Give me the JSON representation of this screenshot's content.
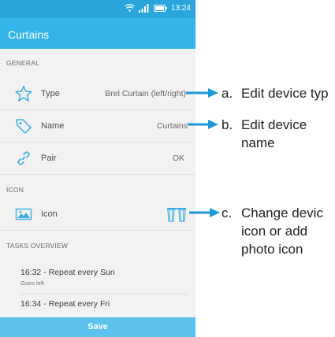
{
  "status_bar": {
    "time": "13:24"
  },
  "app_bar": {
    "title": "Curtains"
  },
  "sections": {
    "general": "GENERAL",
    "icon": "ICON",
    "tasks": "TASKS OVERVIEW"
  },
  "rows": {
    "type": {
      "label": "Type",
      "value": "Brel Curtain (left/right)",
      "icon": "star-icon"
    },
    "name": {
      "label": "Name",
      "value": "Curtains",
      "icon": "tag-icon"
    },
    "pair": {
      "label": "Pair",
      "value": "OK",
      "icon": "link-icon"
    },
    "icon": {
      "label": "Icon",
      "icon": "picture-icon",
      "value_icon": "curtain-icon"
    }
  },
  "tasks": [
    {
      "title": "16:32 - Repeat every Sun",
      "subtitle": "Goes left"
    },
    {
      "title": "16:34 - Repeat every Fri"
    }
  ],
  "save_label": "Save",
  "annotations": {
    "a_letter": "a.",
    "a_text": "Edit device typ",
    "b_letter": "b.",
    "b_text_1": "Edit device",
    "b_text_2": "name",
    "c_letter": "c.",
    "c_text_1": "Change devic",
    "c_text_2": "icon or add",
    "c_text_3": "photo icon"
  },
  "colors": {
    "status_bar": "#2ba6dd",
    "app_bar": "#34b4e9",
    "save_bar": "#5bc3ee",
    "icon_accent": "#3aaee3",
    "arrow": "#1e9ad8"
  }
}
